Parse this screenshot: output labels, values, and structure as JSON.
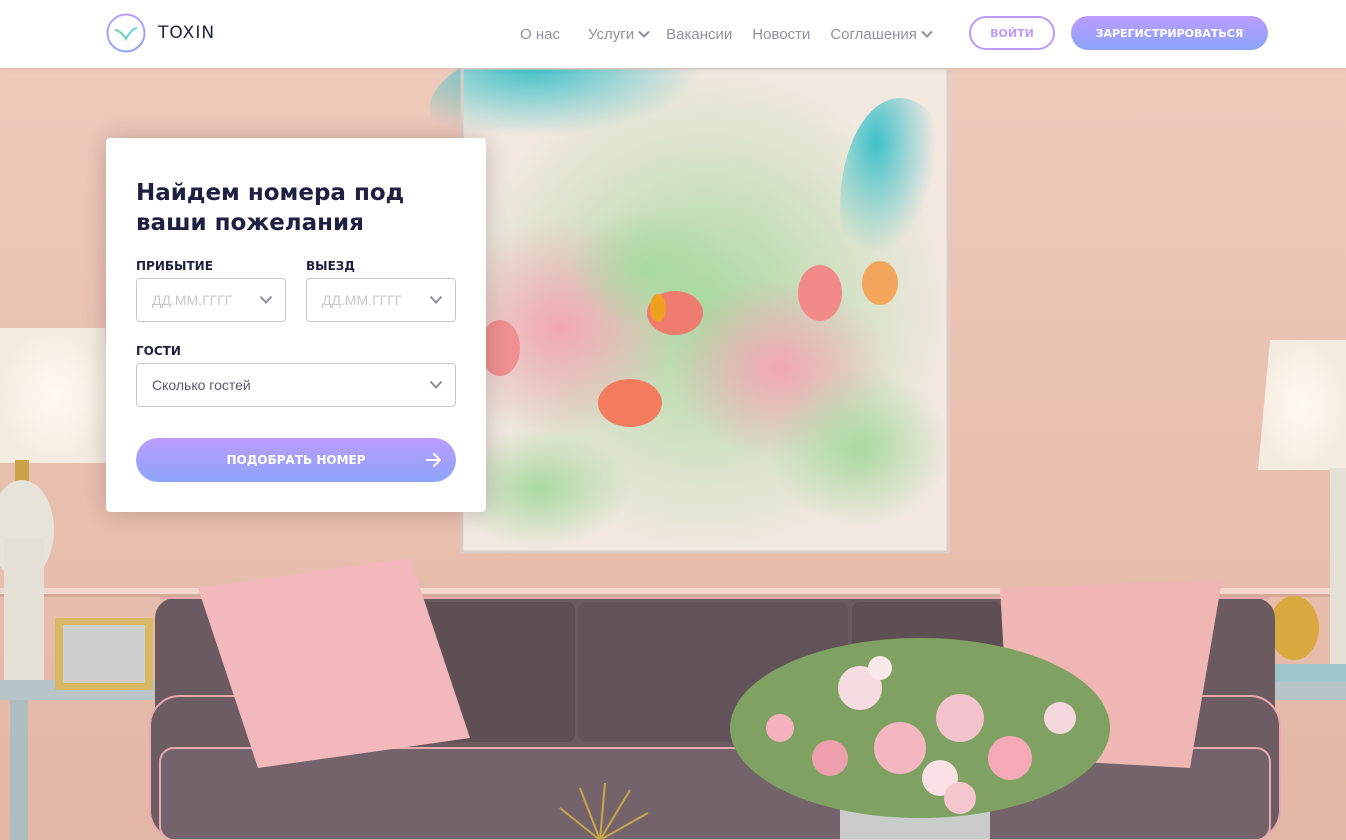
{
  "header": {
    "brand": "TOXIN",
    "nav": [
      {
        "label": "О нас",
        "dropdown": false
      },
      {
        "label": "Услуги",
        "dropdown": true
      },
      {
        "label": "Вакансии",
        "dropdown": false
      },
      {
        "label": "Новости",
        "dropdown": false
      },
      {
        "label": "Соглашения",
        "dropdown": true
      }
    ],
    "login_label": "ВОЙТИ",
    "register_label": "ЗАРЕГИСТРИРОВАТЬСЯ"
  },
  "search_card": {
    "title": "Найдем номера под ваши пожелания",
    "arrival_label": "ПРИБЫТИЕ",
    "arrival_placeholder": "ДД.ММ.ГГГГ",
    "departure_label": "ВЫЕЗД",
    "departure_placeholder": "ДД.ММ.ГГГГ",
    "guests_label": "ГОСТИ",
    "guests_value": "Сколько гостей",
    "submit_label": "ПОДОБРАТЬ НОМЕР"
  },
  "icons": {
    "logo": "toxin-logo-icon",
    "dropdown": "chevron-down-icon",
    "arrow": "arrow-right-icon"
  },
  "colors": {
    "accent": "#bc9cff",
    "accent_end": "#8ba4f9",
    "text_dark": "#1f2041"
  }
}
